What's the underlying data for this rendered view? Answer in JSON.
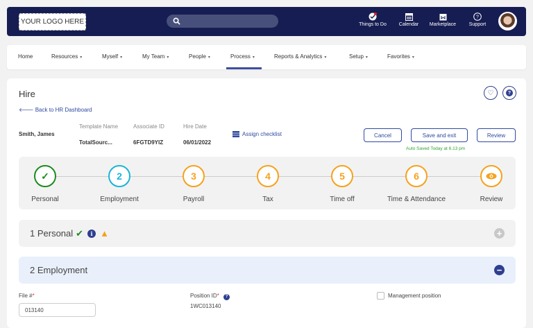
{
  "header": {
    "logo": "YOUR LOGO HERE",
    "search_placeholder": "",
    "icons": [
      {
        "label": "Things to Do",
        "icon": "check-badge-icon"
      },
      {
        "label": "Calendar",
        "icon": "calendar-icon"
      },
      {
        "label": "Marketplace",
        "icon": "marketplace-bag-icon"
      },
      {
        "label": "Support",
        "icon": "question-bubble-icon"
      }
    ]
  },
  "nav": {
    "items": [
      {
        "label": "Home"
      },
      {
        "label": "Resources"
      },
      {
        "label": "Myself"
      },
      {
        "label": "My Team"
      },
      {
        "label": "People"
      },
      {
        "label": "Process",
        "active": true
      },
      {
        "label": "Reports & Analytics"
      },
      {
        "label": "Setup"
      },
      {
        "label": "Favorites"
      }
    ],
    "caret": "▾"
  },
  "page": {
    "title": "Hire",
    "back": "Back to HR Dashboard",
    "name": "Smith, James",
    "fields": [
      {
        "label": "Template Name",
        "value": "TotalSourc..."
      },
      {
        "label": "Associate ID",
        "value": "6FGTD9YIZ"
      },
      {
        "label": "Hire Date",
        "value": "06/01/2022"
      }
    ],
    "assign": "Assign checklist",
    "cancel": "Cancel",
    "save": "Save and exit",
    "review": "Review",
    "autosave": "Auto Saved Today at 6.13 pm"
  },
  "steps": [
    {
      "mark": "✓",
      "label": "Personal",
      "status": "complete",
      "color": "#1e8a1e"
    },
    {
      "mark": "2",
      "label": "Employment",
      "status": "current",
      "color": "#19b5d8"
    },
    {
      "mark": "3",
      "label": "Payroll",
      "color": "#f5a21b"
    },
    {
      "mark": "4",
      "label": "Tax",
      "color": "#f5a21b"
    },
    {
      "mark": "5",
      "label": "Time off",
      "color": "#f5a21b"
    },
    {
      "mark": "6",
      "label": "Time & Attendance",
      "color": "#f5a21b"
    },
    {
      "mark": "",
      "label": "Review",
      "color": "#f5a21b"
    }
  ],
  "sections": {
    "personal": "1 Personal",
    "employment": "2 Employment"
  },
  "form": {
    "file_label": "File #",
    "file_value": "013140",
    "position_label": "Position ID",
    "position_value": "1WC013140",
    "req": "*",
    "management_label": "Management position"
  }
}
